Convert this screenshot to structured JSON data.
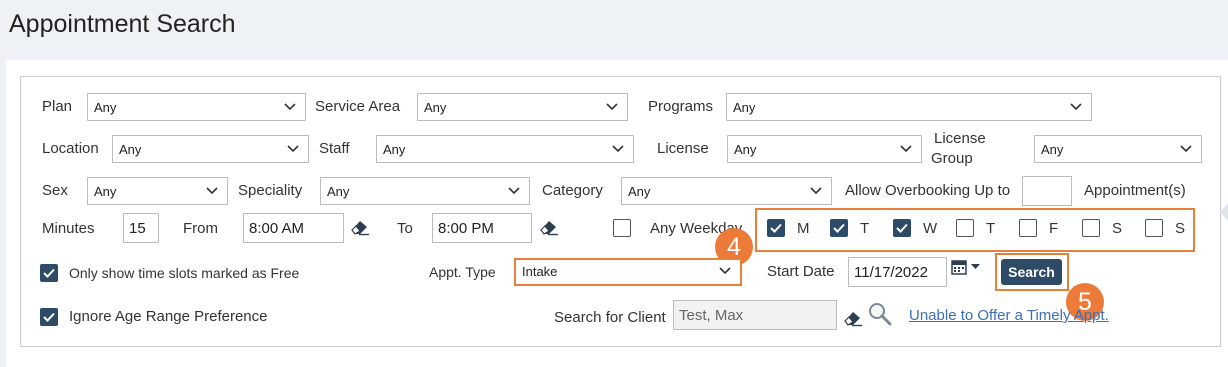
{
  "page": {
    "title": "Appointment Search"
  },
  "filters": {
    "plan_label": "Plan",
    "plan_value": "Any",
    "service_area_label": "Service Area",
    "service_area_value": "Any",
    "programs_label": "Programs",
    "programs_value": "Any",
    "location_label": "Location",
    "location_value": "Any",
    "staff_label": "Staff",
    "staff_value": "Any",
    "license_label": "License",
    "license_value": "Any",
    "license_group_label_1": "License",
    "license_group_label_2": "Group",
    "license_group_value": "Any",
    "sex_label": "Sex",
    "sex_value": "Any",
    "speciality_label": "Speciality",
    "speciality_value": "Any",
    "category_label": "Category",
    "category_value": "Any",
    "overbooking_label": "Allow Overbooking Up to",
    "overbooking_value": "",
    "appointments_label": "Appointment(s)"
  },
  "time": {
    "minutes_label": "Minutes",
    "minutes_value": "15",
    "from_label": "From",
    "from_value": "8:00 AM",
    "to_label": "To",
    "to_value": "8:00 PM",
    "any_weekday_label": "Any Weekday",
    "days": [
      {
        "label": "M",
        "checked": true
      },
      {
        "label": "T",
        "checked": true
      },
      {
        "label": "W",
        "checked": true
      },
      {
        "label": "T",
        "checked": false
      },
      {
        "label": "F",
        "checked": false
      },
      {
        "label": "S",
        "checked": false
      },
      {
        "label": "S",
        "checked": false
      }
    ]
  },
  "options": {
    "free_slots_label": "Only show time slots marked as Free",
    "free_slots_checked": true,
    "ignore_age_label": "Ignore Age Range Preference",
    "ignore_age_checked": true
  },
  "appt": {
    "type_label": "Appt. Type",
    "type_value": "Intake",
    "start_date_label": "Start Date",
    "start_date_value": "11/17/2022",
    "search_button": "Search"
  },
  "client": {
    "label": "Search for Client",
    "value": "Test, Max",
    "link": "Unable to Offer a Timely Appt."
  },
  "callouts": [
    "4",
    "5"
  ],
  "colors": {
    "accent": "#ec7b3a",
    "button": "#2d4a66",
    "link": "#3b6fb6"
  }
}
